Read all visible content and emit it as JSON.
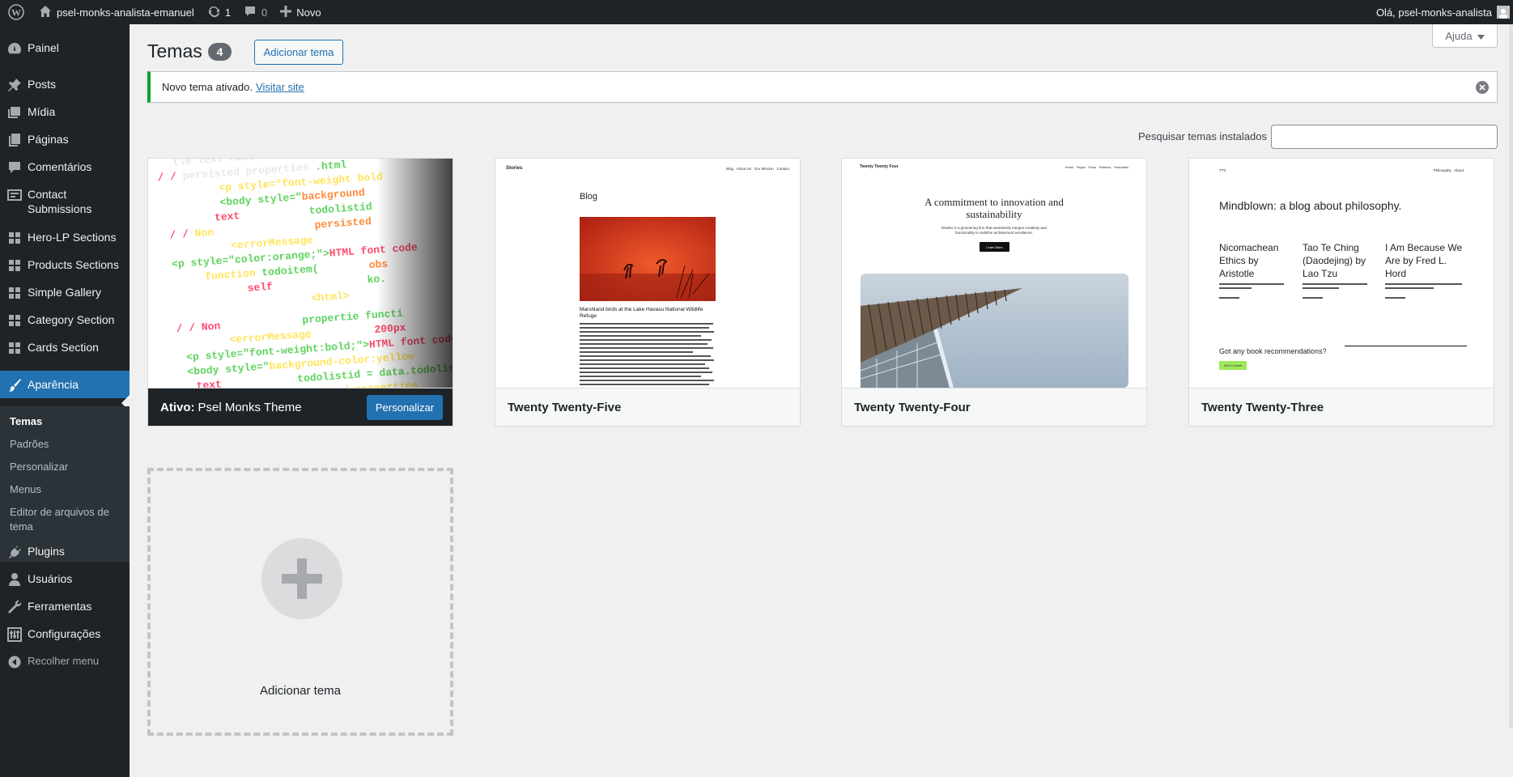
{
  "admin_bar": {
    "site_name": "psel-monks-analista-emanuel",
    "updates_count": "1",
    "comments_count": "0",
    "new_label": "Novo",
    "greeting": "Olá, psel-monks-analista"
  },
  "sidebar": {
    "items": [
      {
        "label": "Painel",
        "icon": "dashboard-icon"
      },
      {
        "label": "Posts",
        "icon": "pin-icon"
      },
      {
        "label": "Mídia",
        "icon": "media-icon"
      },
      {
        "label": "Páginas",
        "icon": "pages-icon"
      },
      {
        "label": "Comentários",
        "icon": "comments-icon"
      },
      {
        "label": "Contact Submissions",
        "icon": "contact-icon"
      },
      {
        "label": "Hero-LP Sections",
        "icon": "grid-icon"
      },
      {
        "label": "Products Sections",
        "icon": "grid-icon"
      },
      {
        "label": "Simple Gallery",
        "icon": "grid-icon"
      },
      {
        "label": "Category Section",
        "icon": "grid-icon"
      },
      {
        "label": "Cards Section",
        "icon": "grid-icon"
      },
      {
        "label": "Aparência",
        "icon": "appearance-icon"
      },
      {
        "label": "Plugins",
        "icon": "plugins-icon"
      },
      {
        "label": "Usuários",
        "icon": "users-icon"
      },
      {
        "label": "Ferramentas",
        "icon": "tools-icon"
      },
      {
        "label": "Configurações",
        "icon": "settings-icon"
      }
    ],
    "submenu": [
      "Temas",
      "Padrões",
      "Personalizar",
      "Menus",
      "Editor de arquivos de tema"
    ],
    "collapse_label": "Recolher menu"
  },
  "page": {
    "title": "Temas",
    "count": "4",
    "add_button": "Adicionar tema",
    "help": "Ajuda"
  },
  "notice": {
    "text": "Novo tema ativado.",
    "link": "Visitar site"
  },
  "search": {
    "label": "Pesquisar temas instalados",
    "value": ""
  },
  "themes": {
    "active": {
      "prefix": "Ativo:",
      "name": "Psel Monks Theme",
      "customize": "Personalizar"
    },
    "tt5": {
      "name": "Twenty Twenty-Five",
      "site": "Stories",
      "nav": "Blog   About Us   Our Mission   Contact",
      "heading": "Blog",
      "caption": "Marshland birds at the Lake Havasu National Wildlife Refuge"
    },
    "tt4": {
      "name": "Twenty Twenty-Four",
      "site": "Twenty Twenty Four",
      "nav": "Home   Pages   Posts   Patterns   Templates",
      "heading": "A commitment to innovation and sustainability",
      "sub": "Études is a pioneering firm that seamlessly merges creativity and functionality to redefine architectural excellence.",
      "button": "Learn More"
    },
    "tt3": {
      "name": "Twenty Twenty-Three",
      "site": "TT3",
      "nav": "Philosophy   About",
      "heading": "Mindblown: a blog about philosophy.",
      "posts": [
        "Nicomachean Ethics by Aristotle",
        "Tao Te Ching (Daodejing) by Lao Tzu",
        "I Am Because We Are by Fred L. Hord"
      ],
      "cta": "Got any book recommendations?",
      "button": "Get In Touch"
    }
  },
  "add_tile": {
    "label": "Adicionar tema"
  }
}
